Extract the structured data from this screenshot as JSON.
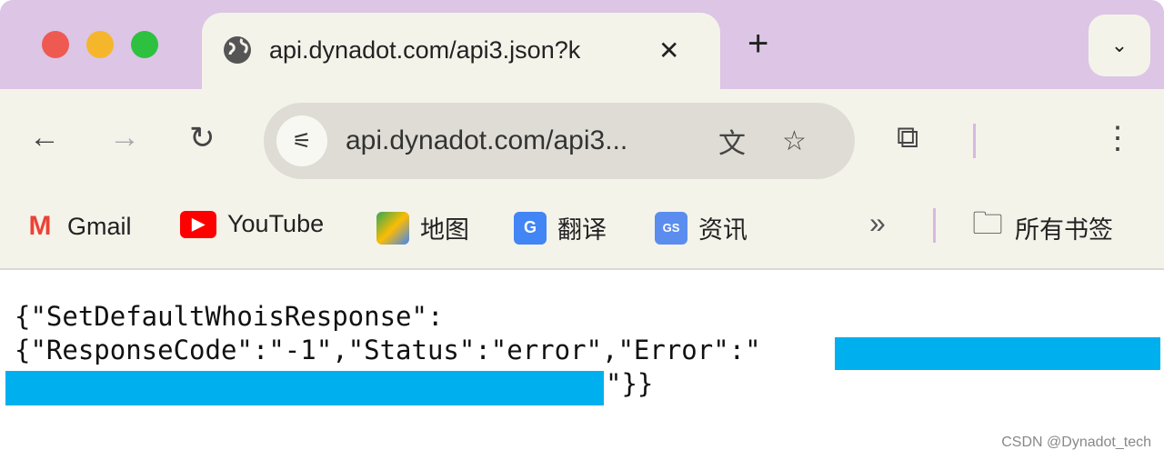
{
  "window": {
    "controls": [
      "close",
      "minimize",
      "zoom"
    ],
    "colors": {
      "close": "#ee5a52",
      "minimize": "#f5b62b",
      "zoom": "#2dc13f",
      "tabstrip": "#dcc5e5",
      "redaction": "#00b0ee"
    }
  },
  "tab": {
    "title": "api.dynadot.com/api3.json?k",
    "close_label": "✕",
    "icon": "globe-icon"
  },
  "new_tab_label": "+",
  "tab_search_label": "⌄",
  "toolbar": {
    "back": "←",
    "forward": "→",
    "reload": "↻",
    "url": "api.dynadot.com/api3...",
    "translate": "文",
    "bookmark": "☆",
    "extensions": "⧉",
    "menu": "⋮"
  },
  "bookmarks": {
    "items": [
      {
        "label": "Gmail",
        "icon": "gmail-icon"
      },
      {
        "label": "YouTube",
        "icon": "youtube-icon"
      },
      {
        "label": "地图",
        "icon": "maps-icon"
      },
      {
        "label": "翻译",
        "icon": "translate-icon"
      },
      {
        "label": "资讯",
        "icon": "news-icon"
      }
    ],
    "more": "»",
    "all_bookmarks": "所有书签"
  },
  "content": {
    "line1": "{\"SetDefaultWhoisResponse\":",
    "line2": "{\"ResponseCode\":\"-1\",\"Status\":\"error\",\"Error\":\"",
    "line3_end": "\"}}"
  },
  "watermark": "CSDN @Dynadot_tech"
}
